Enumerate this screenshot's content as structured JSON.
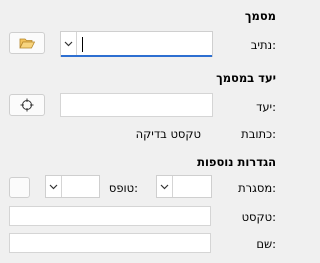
{
  "document_section": {
    "title": "מסמך",
    "path_label": "נתיב:",
    "path_value": "",
    "browse_icon": "folder-open-icon"
  },
  "target_section": {
    "title": "יעד במסמך",
    "target_label": "יעד:",
    "target_value": "",
    "target_icon": "crosshair-icon",
    "text_label": "כתובת:",
    "text_value": "טקסט בדיקה"
  },
  "extra_section": {
    "title": "הגדרות נוספות",
    "frame_label": "מסגרת:",
    "frame_value": "",
    "form_label": "טופס:",
    "form_value": "",
    "text_label": "טקסט:",
    "text_value": "",
    "name_label": "שם:",
    "name_value": ""
  },
  "colors": {
    "background": "#f0f0f0",
    "focus_accent": "#2d6fd1"
  }
}
